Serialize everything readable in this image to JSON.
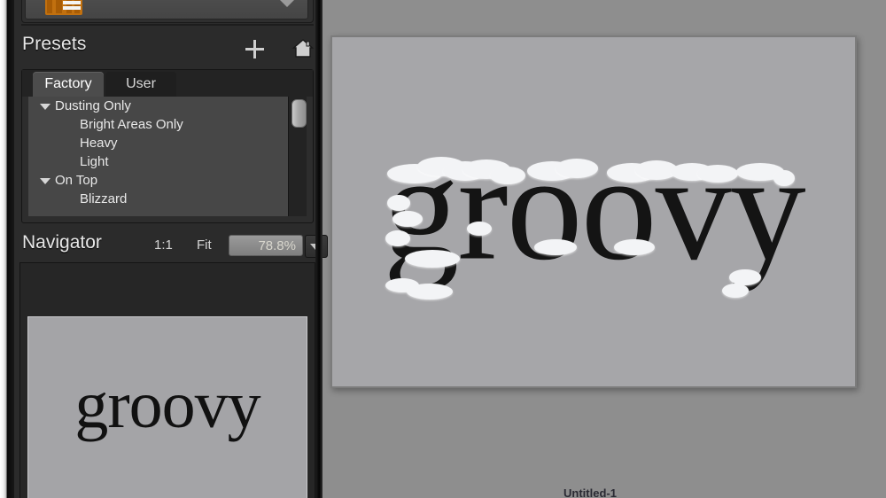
{
  "app": {
    "document_label": "Untitled-1",
    "colors": {
      "panel_bg": "#2b2b2b",
      "workspace_bg": "#8e8e8e",
      "canvas_bg": "#a6a6a9",
      "accent_orange": "#c1700f",
      "text_light": "#e8e8e8"
    }
  },
  "preset_dropdown": {
    "icon": "snow-effect-thumbnail-icon",
    "value": "",
    "chevron": "chevron-down-icon"
  },
  "presets": {
    "title": "Presets",
    "add_icon": "plus-icon",
    "home_icon": "home-icon",
    "tabs": [
      {
        "label": "Factory",
        "active": true
      },
      {
        "label": "User",
        "active": false
      }
    ],
    "tree": [
      {
        "label": "Dusting Only",
        "level": 0,
        "expanded": true
      },
      {
        "label": "Bright Areas Only",
        "level": 1,
        "expanded": false
      },
      {
        "label": "Heavy",
        "level": 1,
        "expanded": false
      },
      {
        "label": "Light",
        "level": 1,
        "expanded": false
      },
      {
        "label": "On Top",
        "level": 0,
        "expanded": true
      },
      {
        "label": "Blizzard",
        "level": 1,
        "expanded": false
      }
    ]
  },
  "navigator": {
    "title": "Navigator",
    "one_to_one_label": "1:1",
    "fit_label": "Fit",
    "zoom_value": "78.8%",
    "zoom_chevron": "chevron-down-icon",
    "thumbnail_text": "groovy"
  },
  "canvas": {
    "text": "groovy",
    "effect": "snow"
  }
}
